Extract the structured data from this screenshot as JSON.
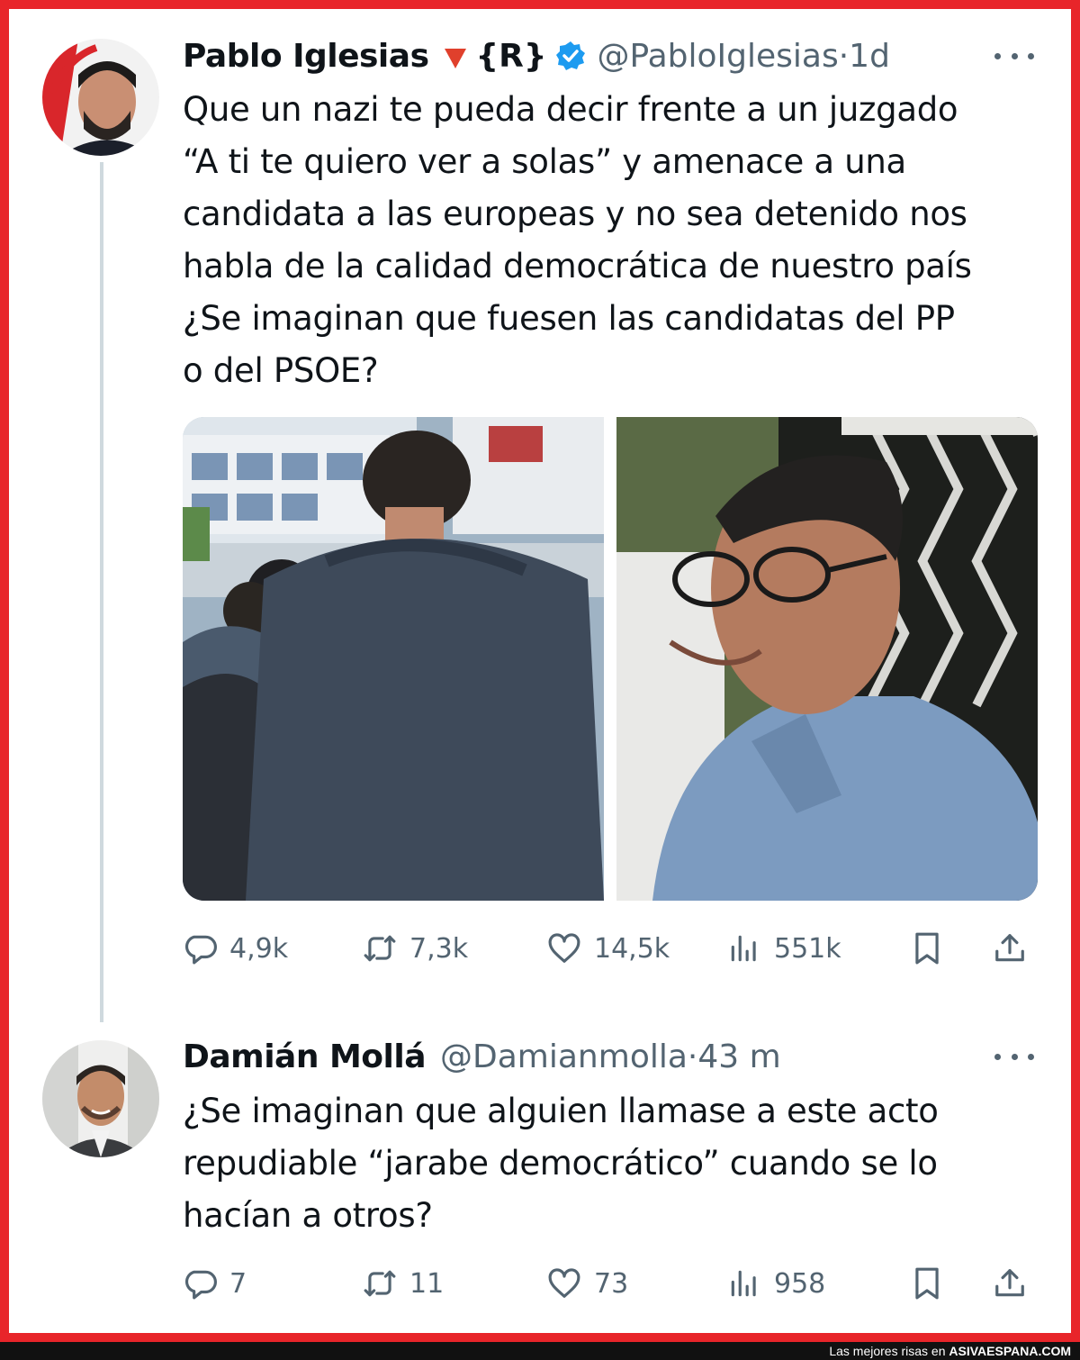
{
  "tweet1": {
    "author_name": "Pablo Iglesias",
    "author_tag": "{R}",
    "handle": "@PabloIglesias",
    "dot": "·",
    "time": "1d",
    "text": "Que un nazi te pueda decir frente a un juzgado\n“A ti te quiero ver a solas” y amenace a una\ncandidata a las europeas y no sea detenido nos\nhabla de la calidad democrática de nuestro país\n¿Se imaginan que fuesen las candidatas del PP\no del PSOE?",
    "stats": {
      "replies": "4,9k",
      "reposts": "7,3k",
      "likes": "14,5k",
      "views": "551k"
    }
  },
  "tweet2": {
    "author_name": "Damián Mollá",
    "handle": "@Damianmolla",
    "dot": "·",
    "time": "43 m",
    "text": "¿Se imaginan que alguien llamase a este acto\nrepudiable “jarabe democrático” cuando se lo\nhacían a otros?",
    "stats": {
      "replies": "7",
      "reposts": "11",
      "likes": "73",
      "views": "958"
    }
  },
  "footer": {
    "prefix": "Las mejores risas en ",
    "site": "ASIVAESPANA.COM"
  },
  "icons": {
    "reply": "reply-icon",
    "repost": "repost-icon",
    "like": "heart-icon",
    "views": "views-icon",
    "bookmark": "bookmark-icon",
    "share": "share-icon",
    "more": "more-icon",
    "verified": "verified-badge-icon",
    "flag": "red-triangle-icon"
  },
  "colors": {
    "frame": "#e8252a",
    "verified": "#1d9bf0",
    "muted": "#536471",
    "text": "#0f1419"
  }
}
